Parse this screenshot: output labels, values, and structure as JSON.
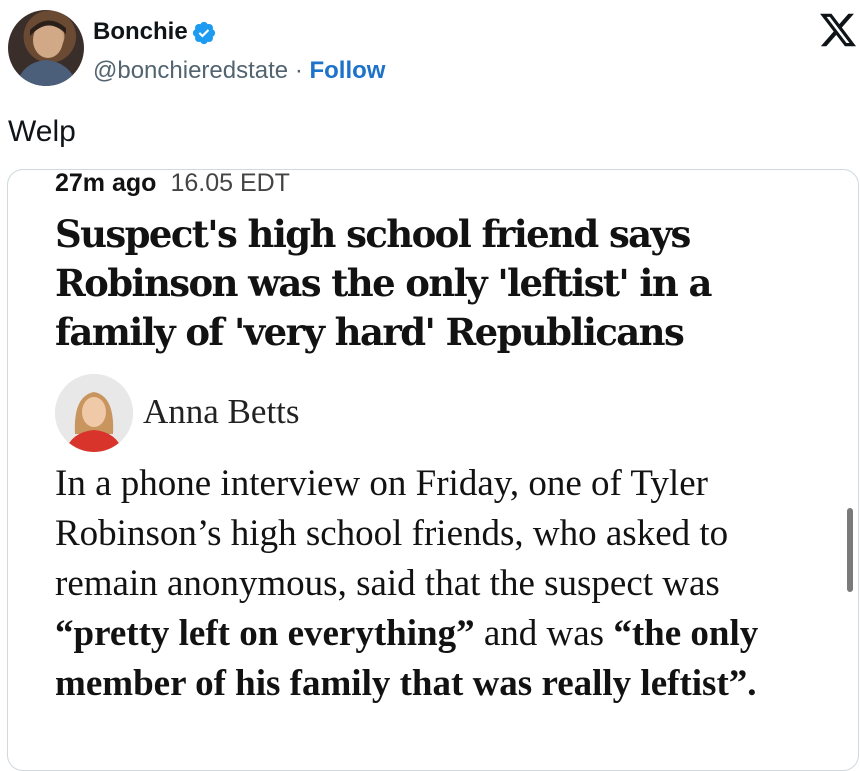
{
  "header": {
    "user_name": "Bonchie",
    "handle": "@bonchieredstate",
    "separator": " · ",
    "follow_label": "Follow"
  },
  "icons": {
    "verified": "verified-badge-icon",
    "logo": "x-logo-icon"
  },
  "colors": {
    "verified": "#1d9bf0",
    "follow": "#1d72c9",
    "text": "#0f1419",
    "muted": "#536471"
  },
  "tweet": {
    "text": "Welp"
  },
  "article": {
    "time_ago": "27m ago",
    "clock_time": "16.05 EDT",
    "headline": "Suspect's high school friend says Robinson was the only 'leftist' in a family of 'very hard' Republicans",
    "author": "Anna Betts",
    "body": {
      "part1": "In a phone interview on Friday, one of Tyler Robinson’s high school friends, who asked to remain anonymous, said that the suspect was ",
      "quote1": "“pretty left on everything”",
      "part2": " and was ",
      "quote2": "“the only member of his family that was really leftist”.",
      "part3": ""
    }
  }
}
